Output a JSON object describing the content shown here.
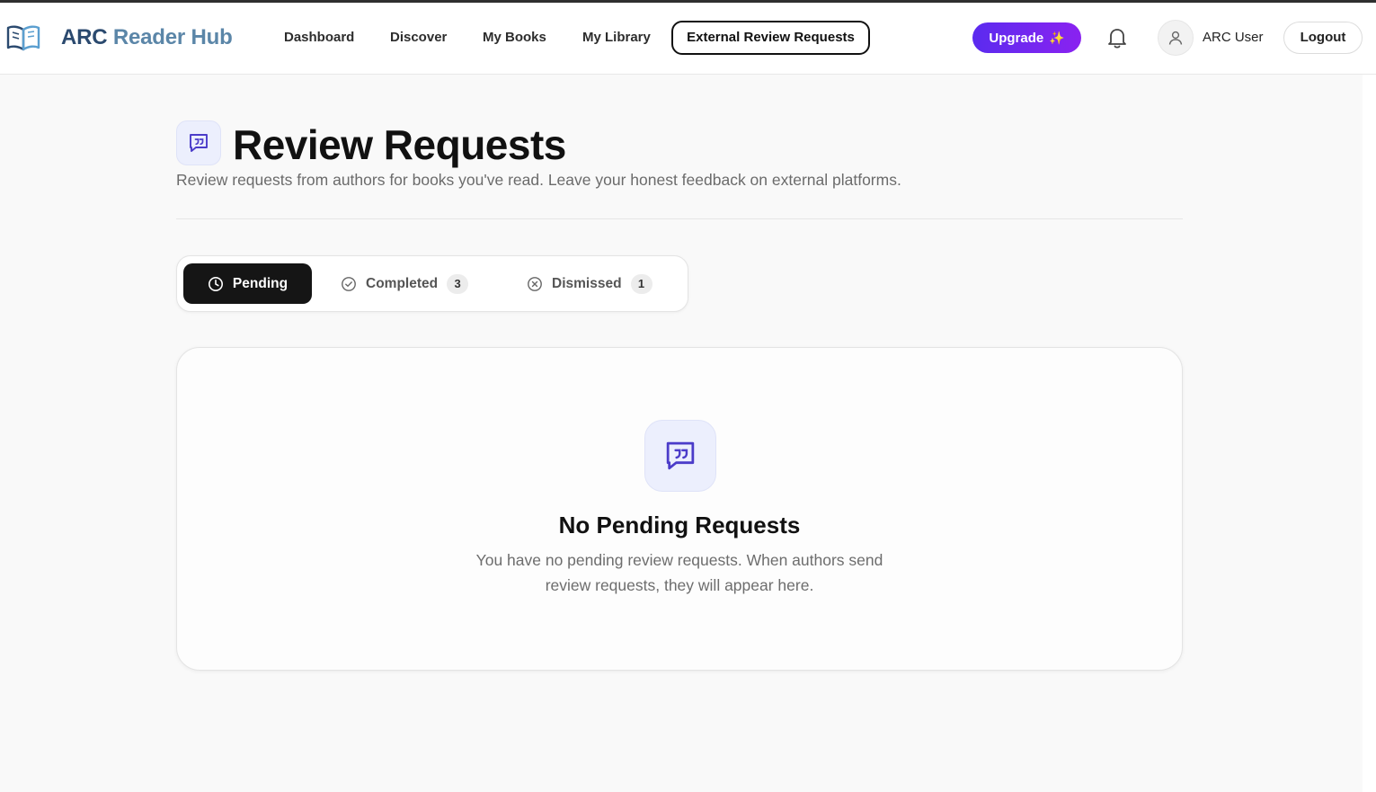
{
  "header": {
    "brand_part1": "ARC",
    "brand_part2": "Reader Hub",
    "nav": {
      "dashboard": "Dashboard",
      "discover": "Discover",
      "my_books": "My Books",
      "my_library": "My Library",
      "external_review_requests": "External Review Requests"
    },
    "upgrade_label": "Upgrade",
    "upgrade_icon": "sparkle-icon",
    "username": "ARC User",
    "logout_label": "Logout"
  },
  "page": {
    "title": "Review Requests",
    "subtitle": "Review requests from authors for books you've read. Leave your honest feedback on external platforms."
  },
  "tabs": {
    "pending": {
      "label": "Pending",
      "icon": "clock-icon"
    },
    "completed": {
      "label": "Completed",
      "count": "3",
      "icon": "check-circle-icon"
    },
    "dismissed": {
      "label": "Dismissed",
      "count": "1",
      "icon": "x-circle-icon"
    }
  },
  "empty_state": {
    "icon": "message-quote-icon",
    "title": "No Pending Requests",
    "text": "You have no pending review requests. When authors send review requests, they will appear here."
  },
  "colors": {
    "accent": "#5b2bef",
    "brand_dark": "#2b4a6f",
    "brand_light": "#5b86a8",
    "icon_purple": "#4b3cc9"
  }
}
